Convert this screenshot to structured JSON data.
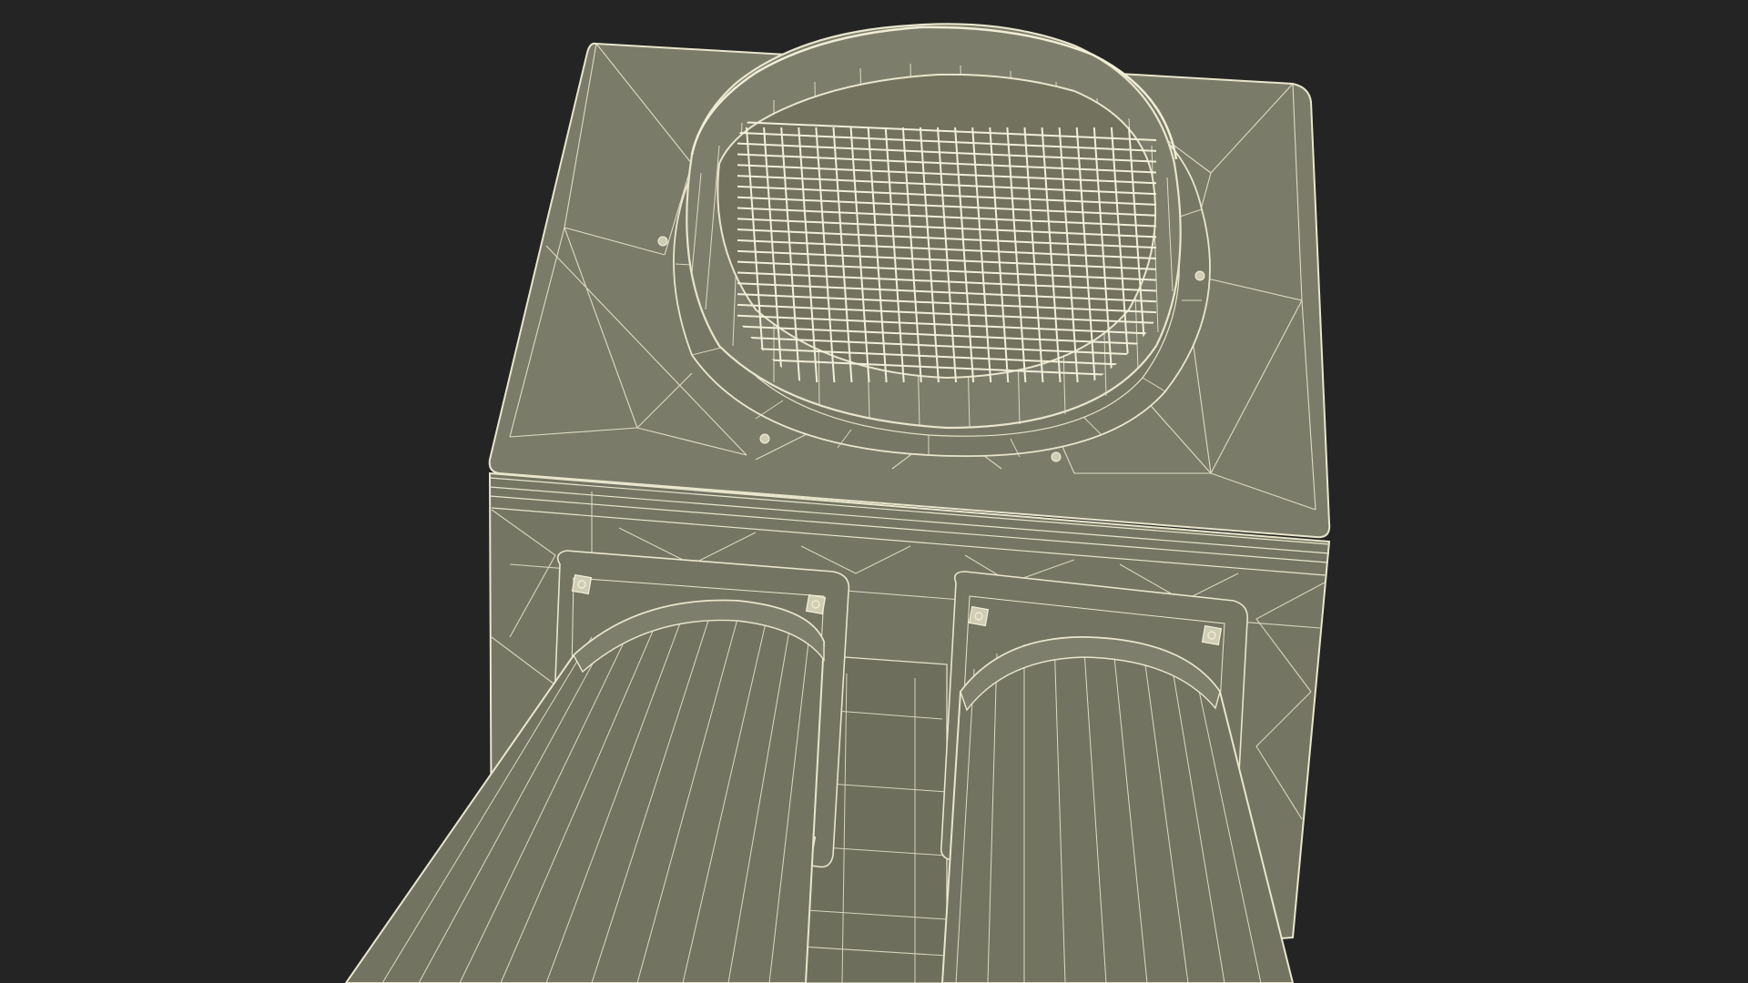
{
  "scene": {
    "subject": "wireframe-3d-model",
    "colors": {
      "background": "#242424",
      "surface": "#7a7a69",
      "surface_dark": "#6a6a5a",
      "surface_light": "#85856f",
      "wire": "#e8e6cc",
      "grate_wire": "#f1efd8"
    },
    "grate": {
      "rows": 22,
      "cols": 22
    }
  }
}
